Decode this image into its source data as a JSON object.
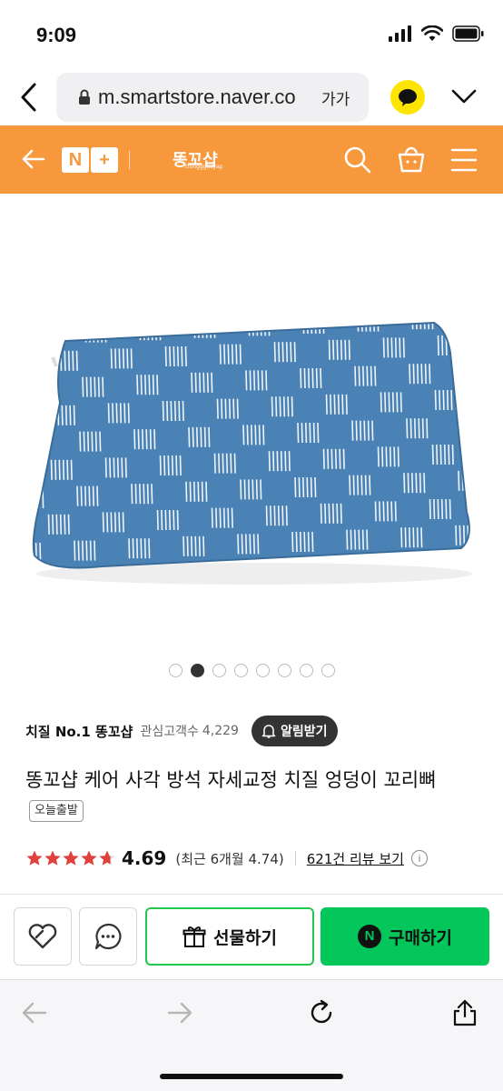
{
  "status": {
    "time": "9:09"
  },
  "browser": {
    "url": "m.smartstore.naver.co",
    "aa_label": "가가"
  },
  "header": {
    "brand_logo": "똥꼬샵",
    "brand_sub": "ttongggosyap",
    "nplus_n": "N",
    "nplus_plus": "+"
  },
  "gallery": {
    "total": 8,
    "active_index": 1
  },
  "store": {
    "name": "치질 No.1 똥꼬샵",
    "follow_label": "관심고객수",
    "follow_count": "4,229",
    "alarm_label": "알림받기"
  },
  "product": {
    "title": "똥꼬샵 케어 사각 방석 자세교정 치질 엉덩이 꼬리뼈",
    "badge": "오늘출발"
  },
  "rating": {
    "score": "4.69",
    "recent": "(최근 6개월 4.74)",
    "review_link": "621건 리뷰 보기",
    "info_icon": "i",
    "stars": 4.69
  },
  "actions": {
    "gift_label": "선물하기",
    "buy_label": "구매하기",
    "buy_icon_letter": "N"
  },
  "colors": {
    "header_orange": "#f7983c",
    "naver_green": "#03c75a",
    "pillow_blue": "#4a82b5"
  }
}
